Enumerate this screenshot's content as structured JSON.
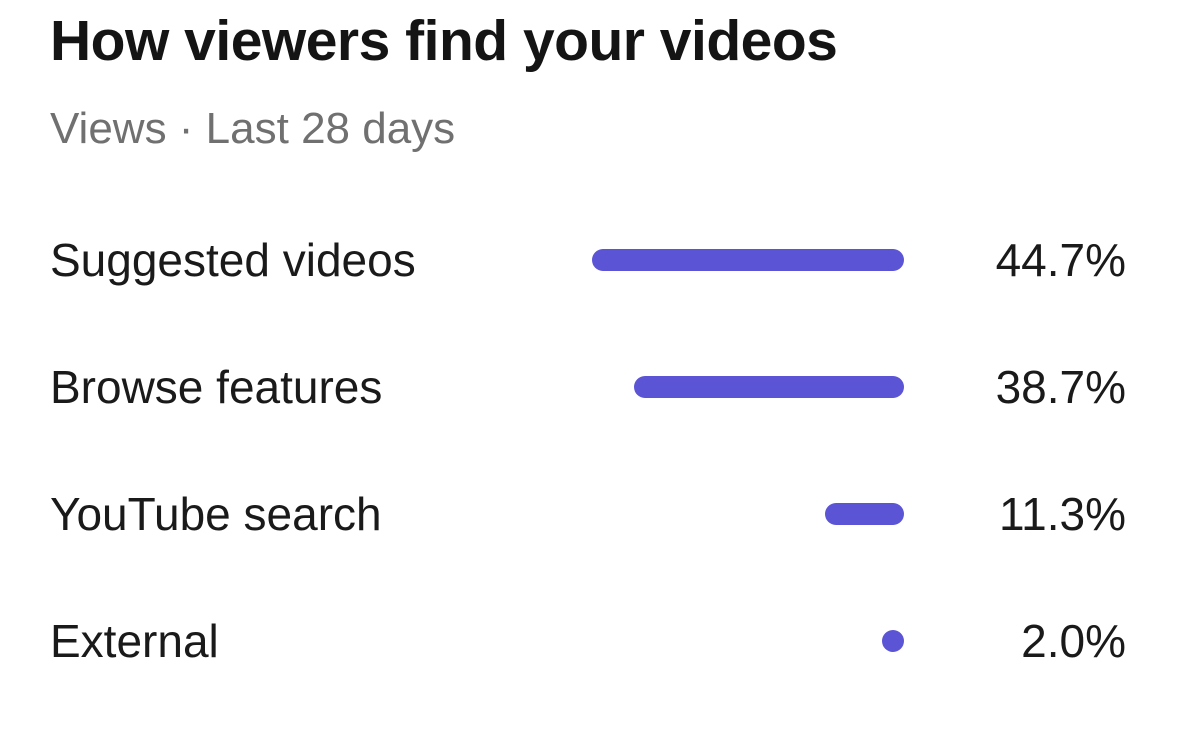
{
  "header": {
    "title": "How viewers find your videos",
    "subtitle": "Views · Last 28 days"
  },
  "colors": {
    "bar": "#5b55d6"
  },
  "chart_data": {
    "type": "bar",
    "orientation": "horizontal",
    "title": "How viewers find your videos",
    "subtitle": "Views · Last 28 days",
    "categories": [
      "Suggested videos",
      "Browse features",
      "YouTube search",
      "External"
    ],
    "values": [
      44.7,
      38.7,
      11.3,
      2.0
    ],
    "value_labels": [
      "44.7%",
      "38.7%",
      "11.3%",
      "2.0%"
    ],
    "xlim": [
      0,
      44.7
    ],
    "grid": false
  }
}
